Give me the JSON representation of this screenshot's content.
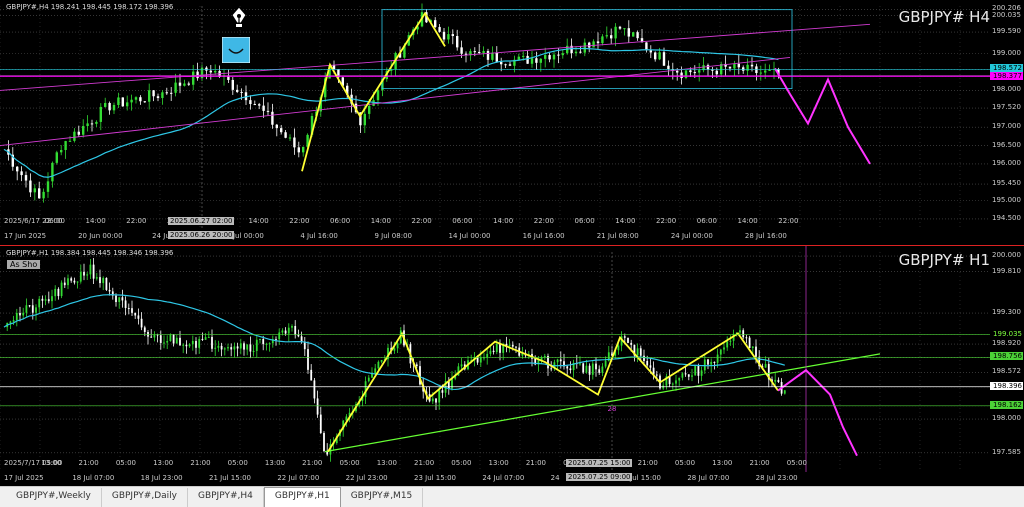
{
  "chart_data": [
    {
      "type": "candlestick",
      "title": "GBPJPY# H4",
      "header": "GBPJPY#,H4 198.241 198.445 198.172 198.396",
      "ylim": [
        194.2,
        200.3
      ],
      "ticks_y": [
        "200.206",
        "200.035",
        "199.590",
        "199.000",
        "198.572",
        "198.377",
        "198.000",
        "197.520",
        "197.000",
        "196.500",
        "196.000",
        "195.450",
        "195.000",
        "194.500"
      ],
      "price_tags": [
        {
          "text": "198.572",
          "bg": "#22c7d8",
          "fg": "#000"
        },
        {
          "text": "198.377",
          "bg": "#ff00ff",
          "fg": "#000"
        }
      ],
      "x_labels": [
        "17 Jun 2025",
        "20 Jun 00:00",
        "24 Jun",
        "2 Jul 00:00",
        "4 Jul 16:00",
        "9 Jul 08:00",
        "14 Jul 00:00",
        "16 Jul 16:00",
        "21 Jul 08:00",
        "24 Jul 00:00",
        "28 Jul 16:00"
      ],
      "x_labels_top": [
        "2025/6/17 22:00",
        "06:00",
        "14:00",
        "22:00",
        "22:00",
        "06:00",
        "14:00",
        "22:00",
        "06:00",
        "14:00",
        "22:00",
        "06:00",
        "14:00",
        "22:00",
        "06:00",
        "14:00",
        "22:00",
        "06:00",
        "14:00",
        "22:00"
      ],
      "crosshair_labels": [
        "2025.06.27 02:00",
        "2025.06.26 20:00"
      ],
      "overlays": [
        "yellow-zigzag",
        "cyan-moving-average",
        "magenta-parallel-channel",
        "magenta-forecast-path",
        "cyan-range-box"
      ]
    },
    {
      "type": "candlestick",
      "title": "GBPJPY# H1",
      "header": "GBPJPY#,H1 198.384 198.445 198.346 198.396",
      "badge": "As Sho",
      "ylim": [
        197.35,
        200.05
      ],
      "ticks_y": [
        "200.000",
        "199.810",
        "199.300",
        "199.035",
        "198.920",
        "198.756",
        "198.572",
        "198.396",
        "198.162",
        "198.000",
        "197.585"
      ],
      "price_tags": [
        {
          "text": "199.035",
          "bg": "#000",
          "fg": "#7fff3f"
        },
        {
          "text": "198.756",
          "bg": "#4cd137",
          "fg": "#000"
        },
        {
          "text": "198.396",
          "bg": "#fff",
          "fg": "#000"
        },
        {
          "text": "198.162",
          "bg": "#4cd137",
          "fg": "#000"
        }
      ],
      "x_labels": [
        "17 Jul 2025",
        "18 Jul 07:00",
        "18 Jul 23:00",
        "21 Jul 15:00",
        "22 Jul 07:00",
        "22 Jul 23:00",
        "23 Jul 15:00",
        "24 Jul 07:00",
        "24",
        "25 Jul 15:00",
        "28 Jul 07:00",
        "28 Jul 23:00"
      ],
      "x_labels_top": [
        "2025/7/17 05:00",
        "13:00",
        "21:00",
        "05:00",
        "13:00",
        "21:00",
        "05:00",
        "13:00",
        "21:00",
        "05:00",
        "13:00",
        "21:00",
        "05:00",
        "13:00",
        "21:00",
        "05:00",
        "13:00",
        "21:00",
        "05:00",
        "13:00",
        "21:00",
        "05:00"
      ],
      "crosshair_labels": [
        "2025.07.25 15:00",
        "2025.07.25 09:00"
      ],
      "marker": "28",
      "overlays": [
        "yellow-zigzag",
        "green-trendline",
        "cyan-moving-average",
        "magenta-forecast-path",
        "horizontal-levels"
      ]
    }
  ],
  "tabs": [
    {
      "label": "GBPJPY#,Weekly"
    },
    {
      "label": "GBPJPY#,Daily"
    },
    {
      "label": "GBPJPY#,H4"
    },
    {
      "label": "GBPJPY#,H1",
      "active": true
    },
    {
      "label": "GBPJPY#,M15"
    }
  ],
  "colors": {
    "bull": "#33dd33",
    "bear": "#ffffff",
    "zigzag": "#ffff33",
    "ma": "#2ec7e6",
    "channel": "#d23bd2",
    "forecast": "#ff33ff",
    "trend": "#66ff33"
  },
  "icons": [
    "pen-nib-icon",
    "smile-face-icon"
  ]
}
